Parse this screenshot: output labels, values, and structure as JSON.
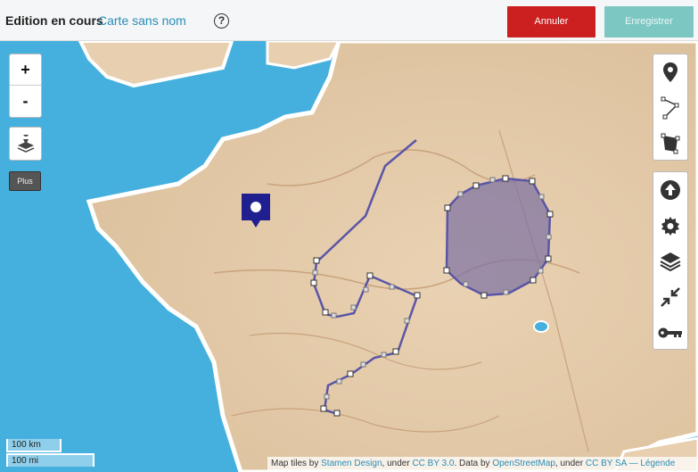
{
  "topbar": {
    "status": "Edition en cours",
    "map_name": "Carte sans nom",
    "help_label": "?",
    "cancel_label": "Annuler",
    "save_label": "Enregistrer"
  },
  "zoom": {
    "in_label": "+",
    "out_label": "-"
  },
  "plus_label": "Plus",
  "scale": {
    "metric": "100 km",
    "imperial": "100 mi"
  },
  "attribution": {
    "prefix": "Map tiles by ",
    "tiles_link": "Stamen Design",
    "mid1": ", under ",
    "ccby_link": "CC BY 3.0",
    "mid2": ". Data by ",
    "osm_link": "OpenStreetMap",
    "mid3": ", under ",
    "ccbysa_link": "CC BY SA",
    "sep": " — ",
    "legend_link": "Légende"
  },
  "colors": {
    "cancel": "#cc1f1f",
    "save": "#7dc7c3",
    "marker": "#1f1f8f",
    "polyline": "#5b55a8",
    "polygon_fill": "#7a6fa3"
  }
}
